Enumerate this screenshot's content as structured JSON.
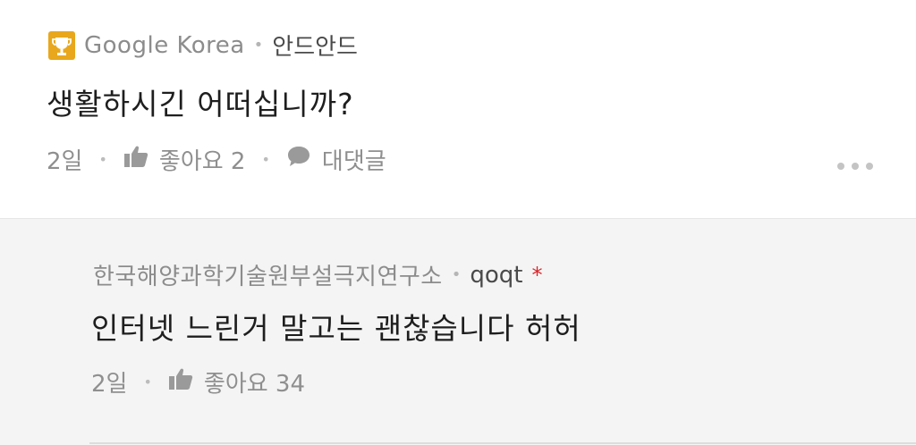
{
  "comment": {
    "author": "Google Korea",
    "nickname": "안드안드",
    "text": "생활하시긴 어떠십니까?",
    "time": "2일",
    "like_label": "좋아요 2",
    "reply_label": "대댓글",
    "badge_icon": "trophy-icon",
    "like_icon": "thumbs-up-icon",
    "reply_icon": "speech-bubble-icon",
    "more_icon": "more-dots-icon"
  },
  "reply": {
    "author": "한국해양과학기술원부설극지연구소",
    "nickname": "qoqt",
    "star": "*",
    "text": "인터넷 느린거 말고는 괜찮습니다 허허",
    "time": "2일",
    "like_label": "좋아요 34",
    "like_icon": "thumbs-up-icon"
  },
  "colors": {
    "badge_gold": "#e8a71c",
    "star_red": "#d9262c",
    "reply_background": "#f4f4f4"
  }
}
